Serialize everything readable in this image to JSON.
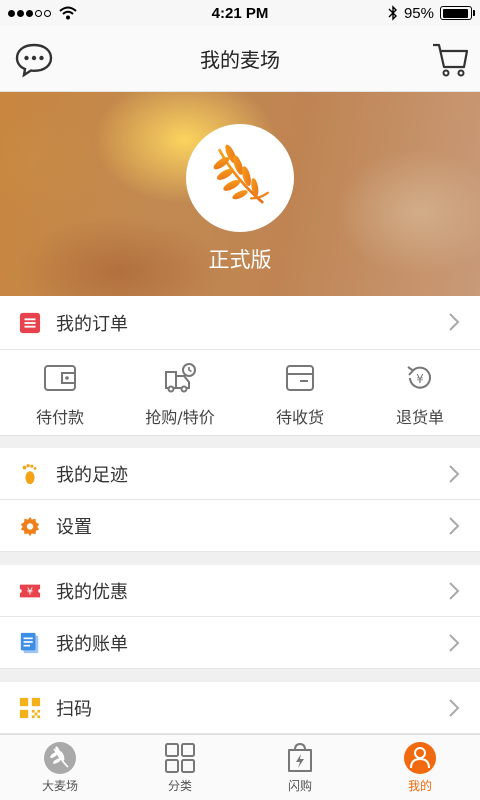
{
  "status_bar": {
    "time": "4:21 PM",
    "battery": "95%",
    "battery_level": 0.95
  },
  "nav": {
    "title": "我的麦场",
    "left_icon": "chat-bubble-icon",
    "right_icon": "cart-icon"
  },
  "banner": {
    "label": "正式版",
    "logo_icon": "wheat-logo-icon"
  },
  "menu": {
    "orders": {
      "label": "我的订单",
      "icon": "order-list-icon"
    },
    "footprint": {
      "label": "我的足迹",
      "icon": "footprint-icon"
    },
    "settings": {
      "label": "设置",
      "icon": "gear-icon"
    },
    "coupons": {
      "label": "我的优惠",
      "icon": "coupon-icon"
    },
    "bills": {
      "label": "我的账单",
      "icon": "bill-icon"
    },
    "scan": {
      "label": "扫码",
      "icon": "qr-scan-icon"
    }
  },
  "order_status": [
    {
      "label": "待付款",
      "icon": "wallet-icon"
    },
    {
      "label": "抢购/特价",
      "icon": "delivery-truck-icon"
    },
    {
      "label": "待收货",
      "icon": "card-box-icon"
    },
    {
      "label": "退货单",
      "icon": "yen-refund-icon"
    }
  ],
  "tabs": [
    {
      "label": "大麦场",
      "icon": "wheat-tab-icon"
    },
    {
      "label": "分类",
      "icon": "grid-icon"
    },
    {
      "label": "闪购",
      "icon": "flash-bag-icon"
    },
    {
      "label": "我的",
      "icon": "person-icon",
      "active": true
    }
  ],
  "colors": {
    "accent": "#f26a10",
    "order_icon": "#e8424c",
    "footprint_icon": "#f4a21a",
    "settings_icon": "#f07f1a",
    "coupon_icon": "#e8424c",
    "bill_icon": "#3d8ee6",
    "scan_icon": "#f4b21a"
  }
}
